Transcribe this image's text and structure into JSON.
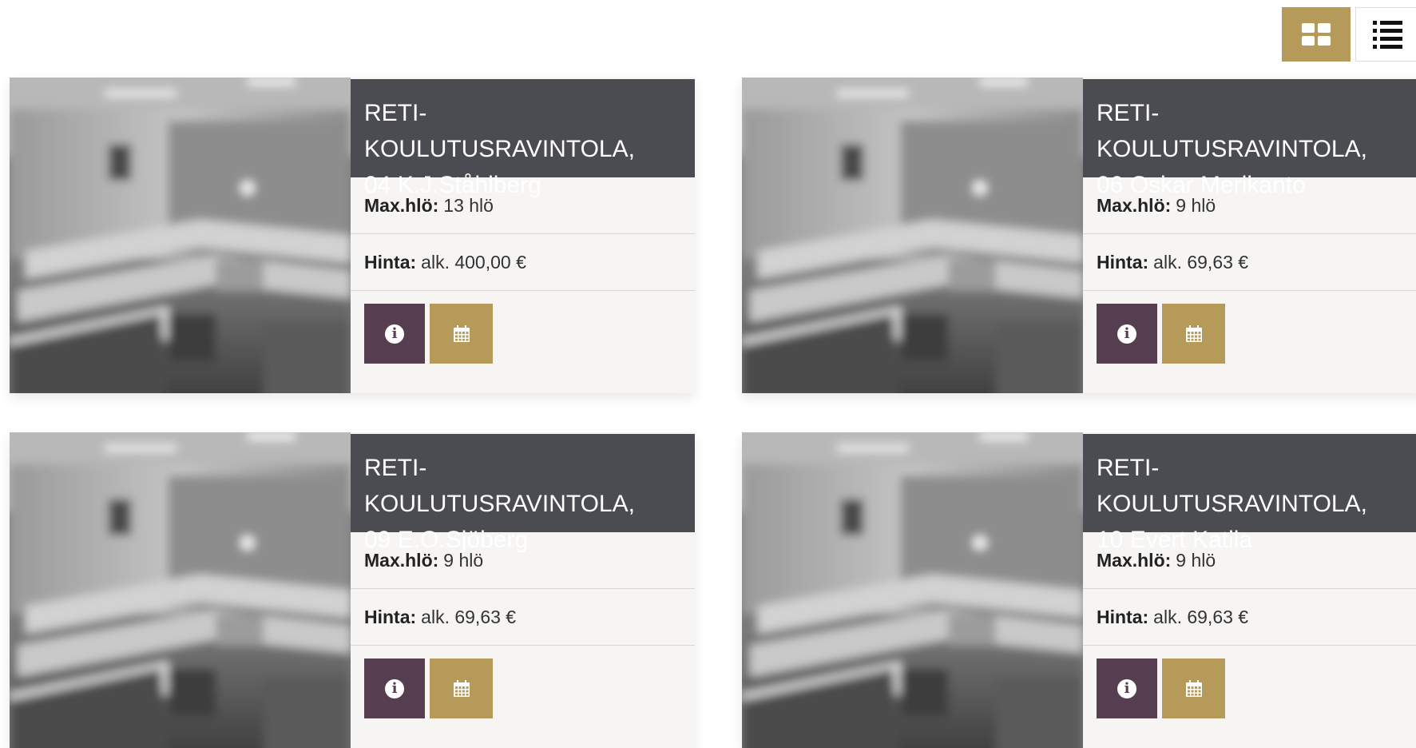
{
  "view_toggle": {
    "grid_icon": "grid-icon",
    "list_icon": "list-icon",
    "active": "grid"
  },
  "colors": {
    "accent_gold": "#b59a5a",
    "info_plum": "#553e4f",
    "title_bar": "#4b4c52",
    "card_bg": "#f6f5f3"
  },
  "cards": [
    {
      "title_line1": "RETI-KOULUTUSRAVINTOLA,",
      "title_line2": "04 K.J.Ståhlberg",
      "capacity_label": "Max.hlö:",
      "capacity_value": "13 hlö",
      "price_label": "Hinta:",
      "price_value": "alk. 400,00 €",
      "info_icon": "info-icon",
      "calendar_icon": "calendar-icon"
    },
    {
      "title_line1": "RETI-KOULUTUSRAVINTOLA,",
      "title_line2": "06 Oskar Merikanto",
      "capacity_label": "Max.hlö:",
      "capacity_value": "9 hlö",
      "price_label": "Hinta:",
      "price_value": "alk. 69,63 €",
      "info_icon": "info-icon",
      "calendar_icon": "calendar-icon"
    },
    {
      "title_line1": "RETI-KOULUTUSRAVINTOLA,",
      "title_line2": "09 E.O.Sjöberg",
      "capacity_label": "Max.hlö:",
      "capacity_value": "9 hlö",
      "price_label": "Hinta:",
      "price_value": "alk. 69,63 €",
      "info_icon": "info-icon",
      "calendar_icon": "calendar-icon"
    },
    {
      "title_line1": "RETI-KOULUTUSRAVINTOLA,",
      "title_line2": "10 Evert Katila",
      "capacity_label": "Max.hlö:",
      "capacity_value": "9 hlö",
      "price_label": "Hinta:",
      "price_value": "alk. 69,63 €",
      "info_icon": "info-icon",
      "calendar_icon": "calendar-icon"
    }
  ]
}
